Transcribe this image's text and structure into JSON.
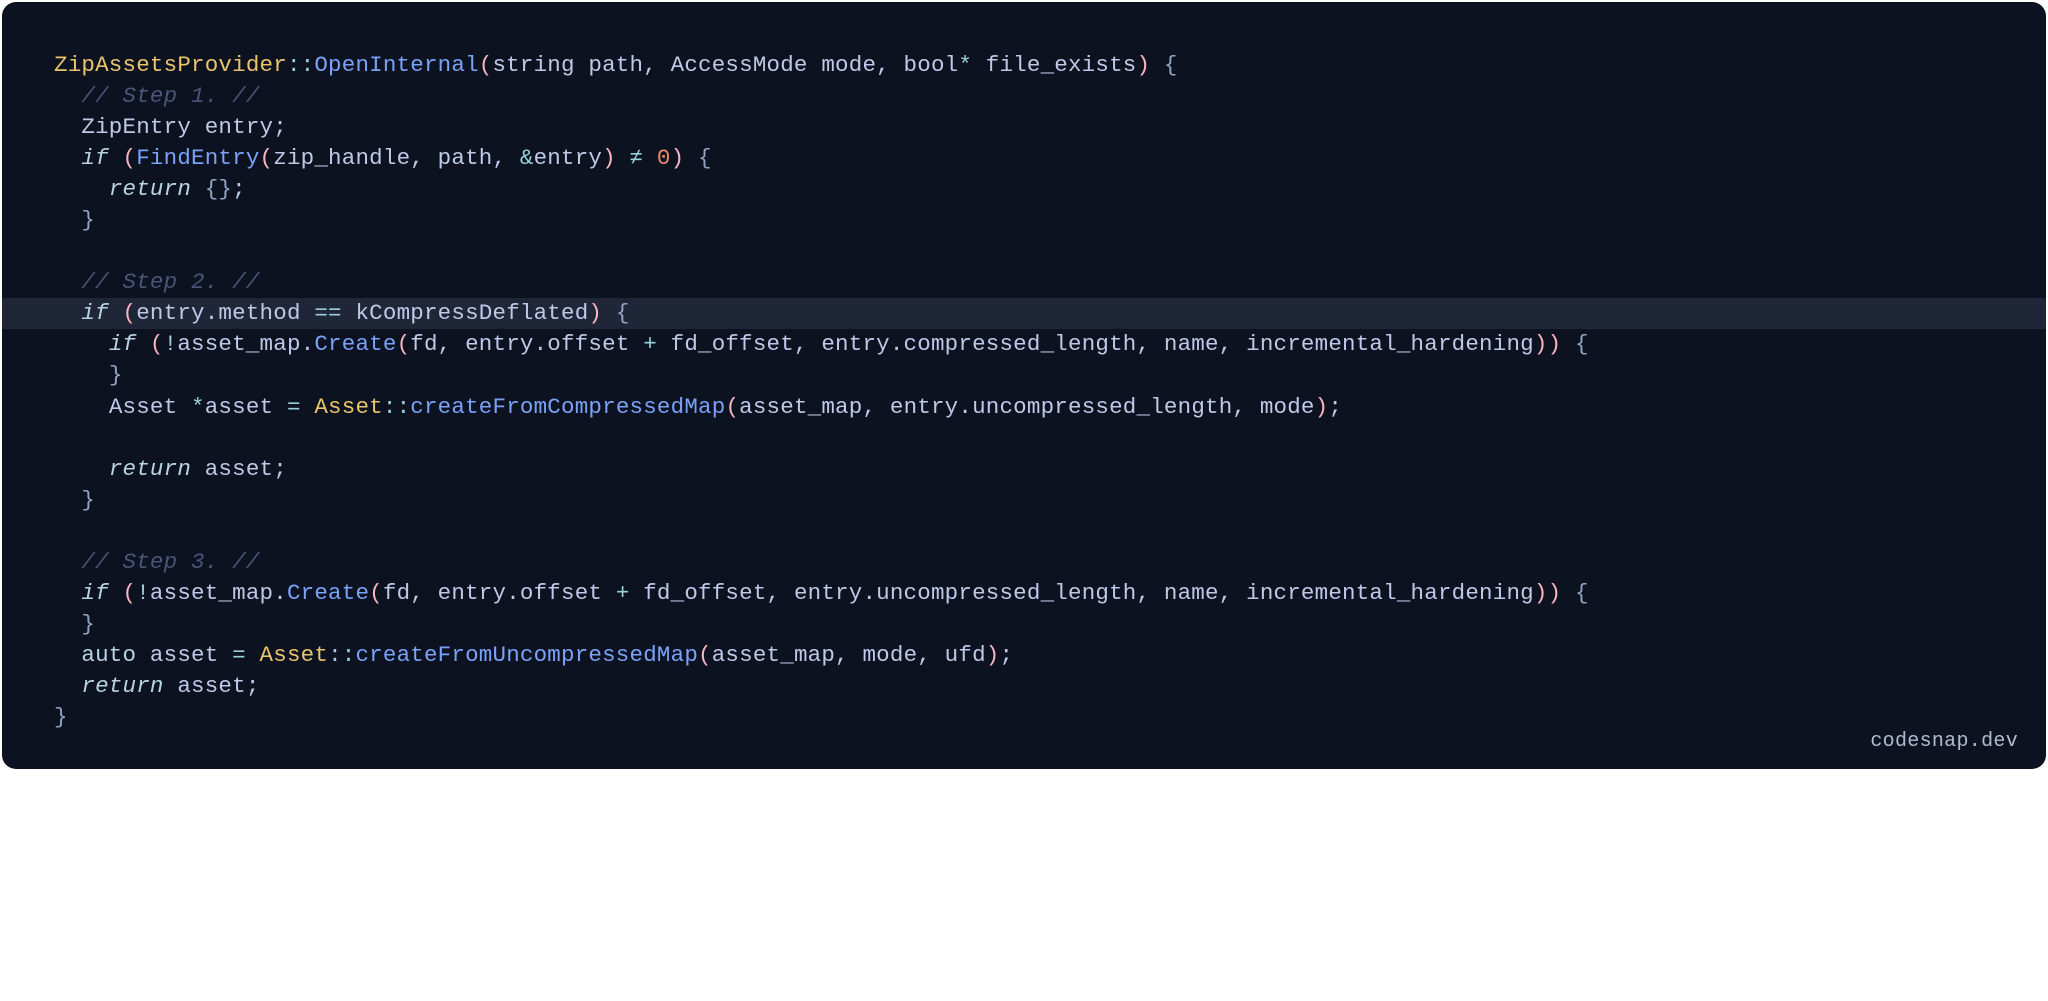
{
  "watermark": "codesnap.dev",
  "code": {
    "lines": [
      {
        "hl": false,
        "indent": 0,
        "tokens": [
          {
            "t": "ZipAssetsProvider",
            "c": "tk-class"
          },
          {
            "t": "::",
            "c": "tk-scope"
          },
          {
            "t": "OpenInternal",
            "c": "tk-func"
          },
          {
            "t": "(",
            "c": "tk-paren"
          },
          {
            "t": "string path, AccessMode mode, bool",
            "c": "tk-default"
          },
          {
            "t": "*",
            "c": "tk-op"
          },
          {
            "t": " file_exists",
            "c": "tk-default"
          },
          {
            "t": ")",
            "c": "tk-paren"
          },
          {
            "t": " ",
            "c": "tk-default"
          },
          {
            "t": "{",
            "c": "tk-curly"
          }
        ]
      },
      {
        "hl": false,
        "indent": 1,
        "tokens": [
          {
            "t": "// Step 1. //",
            "c": "tk-comment"
          }
        ]
      },
      {
        "hl": false,
        "indent": 1,
        "tokens": [
          {
            "t": "ZipEntry entry;",
            "c": "tk-default"
          }
        ]
      },
      {
        "hl": false,
        "indent": 1,
        "tokens": [
          {
            "t": "if",
            "c": "tk-keyword"
          },
          {
            "t": " ",
            "c": "tk-default"
          },
          {
            "t": "(",
            "c": "tk-paren"
          },
          {
            "t": "FindEntry",
            "c": "tk-func"
          },
          {
            "t": "(",
            "c": "tk-paren"
          },
          {
            "t": "zip_handle, path, ",
            "c": "tk-default"
          },
          {
            "t": "&",
            "c": "tk-op"
          },
          {
            "t": "entry",
            "c": "tk-default"
          },
          {
            "t": ")",
            "c": "tk-paren"
          },
          {
            "t": " ",
            "c": "tk-default"
          },
          {
            "t": "≠",
            "c": "tk-op"
          },
          {
            "t": " ",
            "c": "tk-default"
          },
          {
            "t": "0",
            "c": "tk-num"
          },
          {
            "t": ")",
            "c": "tk-paren"
          },
          {
            "t": " ",
            "c": "tk-default"
          },
          {
            "t": "{",
            "c": "tk-curly"
          }
        ]
      },
      {
        "hl": false,
        "indent": 2,
        "tokens": [
          {
            "t": "return",
            "c": "tk-keyword"
          },
          {
            "t": " ",
            "c": "tk-default"
          },
          {
            "t": "{}",
            "c": "tk-curly"
          },
          {
            "t": ";",
            "c": "tk-default"
          }
        ]
      },
      {
        "hl": false,
        "indent": 1,
        "tokens": [
          {
            "t": "}",
            "c": "tk-curly"
          }
        ]
      },
      {
        "hl": false,
        "indent": 0,
        "tokens": [
          {
            "t": "",
            "c": "tk-default"
          }
        ]
      },
      {
        "hl": false,
        "indent": 1,
        "tokens": [
          {
            "t": "// Step 2. //",
            "c": "tk-comment"
          }
        ]
      },
      {
        "hl": true,
        "indent": 1,
        "tokens": [
          {
            "t": "if",
            "c": "tk-keyword"
          },
          {
            "t": " ",
            "c": "tk-default"
          },
          {
            "t": "(",
            "c": "tk-paren"
          },
          {
            "t": "entry.method ",
            "c": "tk-default"
          },
          {
            "t": "==",
            "c": "tk-op"
          },
          {
            "t": " kCompressDeflated",
            "c": "tk-default"
          },
          {
            "t": ")",
            "c": "tk-paren"
          },
          {
            "t": " ",
            "c": "tk-default"
          },
          {
            "t": "{",
            "c": "tk-curly"
          }
        ]
      },
      {
        "hl": false,
        "indent": 2,
        "tokens": [
          {
            "t": "if",
            "c": "tk-keyword"
          },
          {
            "t": " ",
            "c": "tk-default"
          },
          {
            "t": "(",
            "c": "tk-paren"
          },
          {
            "t": "!",
            "c": "tk-op"
          },
          {
            "t": "asset_map.",
            "c": "tk-default"
          },
          {
            "t": "Create",
            "c": "tk-func"
          },
          {
            "t": "(",
            "c": "tk-paren"
          },
          {
            "t": "fd, entry.offset ",
            "c": "tk-default"
          },
          {
            "t": "+",
            "c": "tk-op"
          },
          {
            "t": " fd_offset, entry.compressed_length, name, incremental_hardening",
            "c": "tk-default"
          },
          {
            "t": ")",
            "c": "tk-paren"
          },
          {
            "t": ")",
            "c": "tk-paren"
          },
          {
            "t": " ",
            "c": "tk-default"
          },
          {
            "t": "{",
            "c": "tk-curly"
          }
        ]
      },
      {
        "hl": false,
        "indent": 2,
        "tokens": [
          {
            "t": "}",
            "c": "tk-curly"
          }
        ]
      },
      {
        "hl": false,
        "indent": 2,
        "tokens": [
          {
            "t": "Asset ",
            "c": "tk-default"
          },
          {
            "t": "*",
            "c": "tk-op"
          },
          {
            "t": "asset ",
            "c": "tk-default"
          },
          {
            "t": "=",
            "c": "tk-op"
          },
          {
            "t": " ",
            "c": "tk-default"
          },
          {
            "t": "Asset",
            "c": "tk-class"
          },
          {
            "t": "::",
            "c": "tk-scope"
          },
          {
            "t": "createFromCompressedMap",
            "c": "tk-func"
          },
          {
            "t": "(",
            "c": "tk-paren"
          },
          {
            "t": "asset_map, entry.uncompressed_length, mode",
            "c": "tk-default"
          },
          {
            "t": ")",
            "c": "tk-paren"
          },
          {
            "t": ";",
            "c": "tk-default"
          }
        ]
      },
      {
        "hl": false,
        "indent": 0,
        "tokens": [
          {
            "t": "",
            "c": "tk-default"
          }
        ]
      },
      {
        "hl": false,
        "indent": 2,
        "tokens": [
          {
            "t": "return",
            "c": "tk-keyword"
          },
          {
            "t": " asset;",
            "c": "tk-default"
          }
        ]
      },
      {
        "hl": false,
        "indent": 1,
        "tokens": [
          {
            "t": "}",
            "c": "tk-curly"
          }
        ]
      },
      {
        "hl": false,
        "indent": 0,
        "tokens": [
          {
            "t": "",
            "c": "tk-default"
          }
        ]
      },
      {
        "hl": false,
        "indent": 1,
        "tokens": [
          {
            "t": "// Step 3. //",
            "c": "tk-comment"
          }
        ]
      },
      {
        "hl": false,
        "indent": 1,
        "tokens": [
          {
            "t": "if",
            "c": "tk-keyword"
          },
          {
            "t": " ",
            "c": "tk-default"
          },
          {
            "t": "(",
            "c": "tk-paren"
          },
          {
            "t": "!",
            "c": "tk-op"
          },
          {
            "t": "asset_map.",
            "c": "tk-default"
          },
          {
            "t": "Create",
            "c": "tk-func"
          },
          {
            "t": "(",
            "c": "tk-paren"
          },
          {
            "t": "fd, entry.offset ",
            "c": "tk-default"
          },
          {
            "t": "+",
            "c": "tk-op"
          },
          {
            "t": " fd_offset, entry.uncompressed_length, name, incremental_hardening",
            "c": "tk-default"
          },
          {
            "t": ")",
            "c": "tk-paren"
          },
          {
            "t": ")",
            "c": "tk-paren"
          },
          {
            "t": " ",
            "c": "tk-default"
          },
          {
            "t": "{",
            "c": "tk-curly"
          }
        ]
      },
      {
        "hl": false,
        "indent": 1,
        "tokens": [
          {
            "t": "}",
            "c": "tk-curly"
          }
        ]
      },
      {
        "hl": false,
        "indent": 1,
        "tokens": [
          {
            "t": "auto",
            "c": "tk-auto"
          },
          {
            "t": " asset ",
            "c": "tk-default"
          },
          {
            "t": "=",
            "c": "tk-op"
          },
          {
            "t": " ",
            "c": "tk-default"
          },
          {
            "t": "Asset",
            "c": "tk-class"
          },
          {
            "t": "::",
            "c": "tk-scope"
          },
          {
            "t": "createFromUncompressedMap",
            "c": "tk-func"
          },
          {
            "t": "(",
            "c": "tk-paren"
          },
          {
            "t": "asset_map, mode, ufd",
            "c": "tk-default"
          },
          {
            "t": ")",
            "c": "tk-paren"
          },
          {
            "t": ";",
            "c": "tk-default"
          }
        ]
      },
      {
        "hl": false,
        "indent": 1,
        "tokens": [
          {
            "t": "return",
            "c": "tk-keyword"
          },
          {
            "t": " asset;",
            "c": "tk-default"
          }
        ]
      },
      {
        "hl": false,
        "indent": 0,
        "tokens": [
          {
            "t": "}",
            "c": "tk-curly"
          }
        ]
      }
    ]
  }
}
